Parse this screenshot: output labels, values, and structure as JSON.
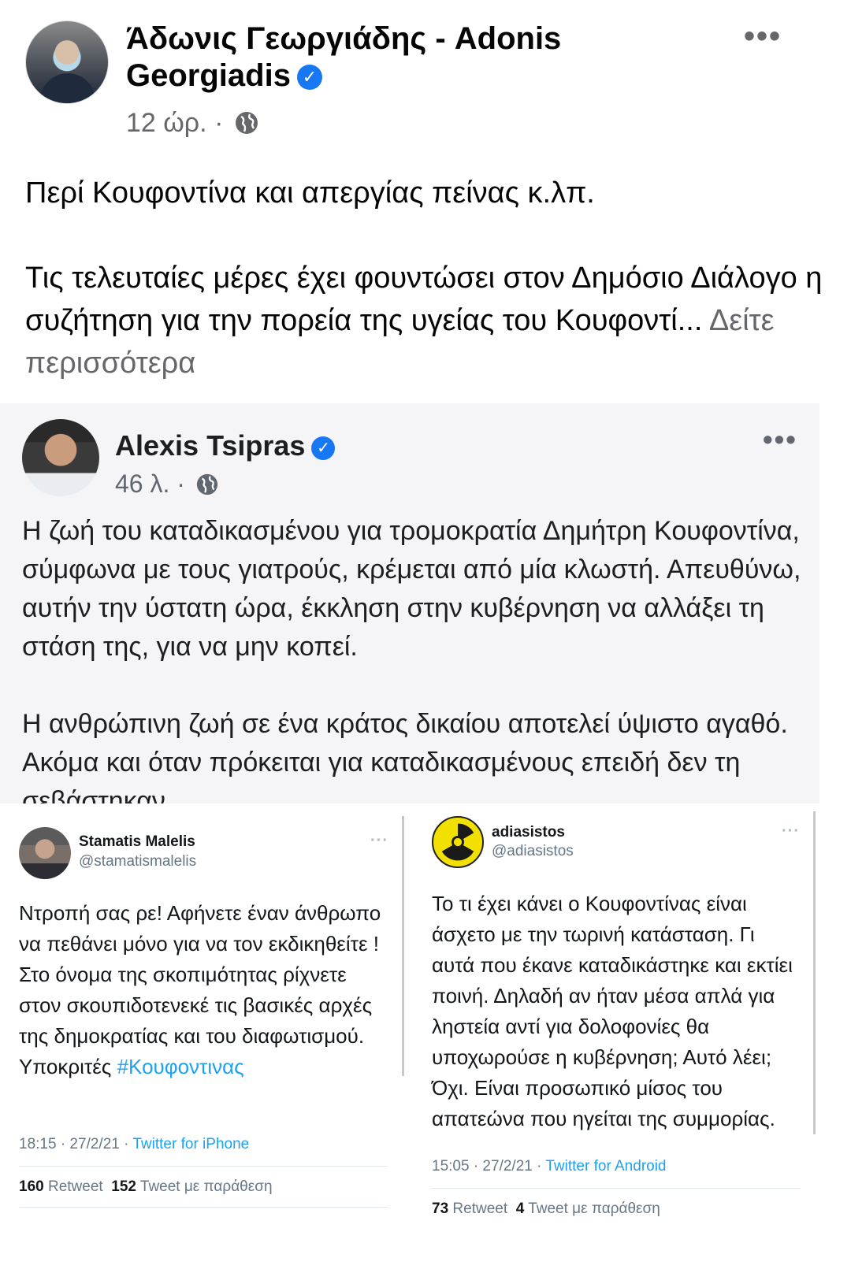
{
  "post": {
    "author": "Άδωνις Γεωργιάδης - Adonis Georgiadis",
    "verified_mark": "✓",
    "time": "12 ώρ.",
    "separator": "·",
    "privacy_icon": "globe-icon",
    "more_label": "•••",
    "text_line1": "Περί Κουφοντίνα και απεργίας πείνας κ.λπ.",
    "text_para2": "Τις τελευταίες μέρες έχει φουντώσει στον Δημόσιο Διάλογο η συζήτηση για την πορεία της υγείας του Κουφοντί...",
    "see_more": "Δείτε περισσότερα"
  },
  "tsipras_post": {
    "author": "Alexis Tsipras",
    "verified_mark": "✓",
    "time": "46 λ.",
    "separator": "·",
    "more_label": "•••",
    "para1": "Η ζωή του καταδικασμένου για τρομοκρατία Δημήτρη Κουφοντίνα, σύμφωνα με τους γιατρούς, κρέμεται από μία κλωστή. Απευθύνω, αυτήν την ύστατη ώρα, έκκληση στην κυβέρνηση να αλλάξει τη στάση της, για να μην κοπεί.",
    "para2": "Η ανθρώπινη ζωή σε ένα κράτος δικαίου αποτελεί ύψιστο αγαθό. Ακόμα και όταν πρόκειται για καταδικασμένους επειδή δεν τη σεβάστηκαν"
  },
  "tweets": [
    {
      "name": "Stamatis Malelis",
      "handle": "@stamatismalelis",
      "more_label": "···",
      "body": "Ντροπή σας ρε! Αφήνετε έναν άνθρωπο να πεθάνει μόνο για να τον εκδικηθείτε ! Στο όνομα της σκοπιμότητας ρίχνετε στον σκουπιδοτενεκέ τις βασικές αρχές της δημοκρατίας και του διαφωτισμού. Υποκριτές",
      "hashtag": "#Κουφοντινας",
      "timestamp": "18:15 · 27/2/21 ·",
      "source": "Twitter for iPhone",
      "retweets": "160",
      "retweets_label": "Retweet",
      "quotes": "152",
      "quotes_label": "Tweet με παράθεση"
    },
    {
      "name": "adiasistos",
      "handle": "@adiasistos",
      "more_label": "···",
      "body": "Το τι έχει κάνει ο Κουφοντίνας είναι άσχετο με την τωρινή κατάσταση. Γι αυτά που έκανε καταδικάστηκε και εκτίει ποινή. Δηλαδή αν ήταν μέσα απλά για ληστεία αντί για δολοφονίες θα υποχωρούσε η κυβέρνηση; Αυτό λέει; Όχι. Είναι προσωπικό μίσος του απατεώνα που ηγείται της συμμορίας.",
      "timestamp": "15:05 · 27/2/21 ·",
      "source": "Twitter for Android",
      "retweets": "73",
      "retweets_label": "Retweet",
      "quotes": "4",
      "quotes_label": "Tweet με παράθεση"
    }
  ],
  "colors": {
    "verified": "#1877f2",
    "twitter_link": "#1da1f2",
    "meta_grey": "#65676b"
  }
}
